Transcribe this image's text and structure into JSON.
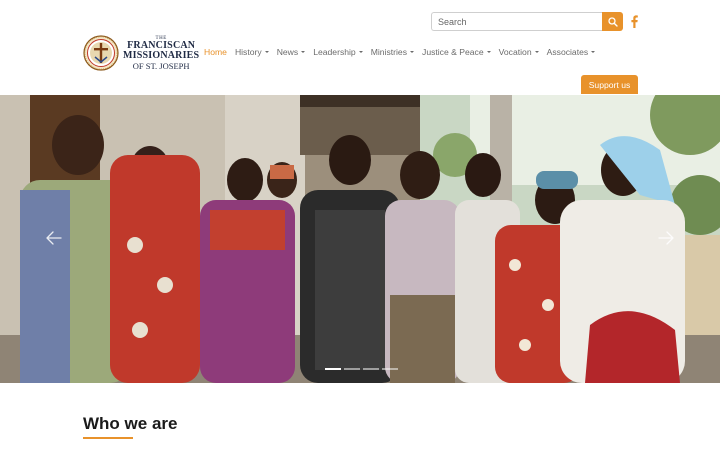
{
  "search": {
    "placeholder": "Search"
  },
  "social": {
    "icon": "facebook-icon"
  },
  "brand": {
    "the": "THE",
    "line1": "FRANCISCAN",
    "line2": "MISSIONARIES",
    "line3": "OF ST. JOSEPH"
  },
  "nav": {
    "items": [
      {
        "label": "Home",
        "dropdown": false,
        "active": true
      },
      {
        "label": "History",
        "dropdown": true
      },
      {
        "label": "News",
        "dropdown": true
      },
      {
        "label": "Leadership",
        "dropdown": true
      },
      {
        "label": "Ministries",
        "dropdown": true
      },
      {
        "label": "Justice & Peace",
        "dropdown": true
      },
      {
        "label": "Vocation",
        "dropdown": true
      },
      {
        "label": "Associates",
        "dropdown": true
      }
    ]
  },
  "support_label": "Support us",
  "carousel": {
    "slides": 4,
    "active_index": 0
  },
  "section": {
    "title": "Who we are"
  },
  "colors": {
    "accent": "#e8922b",
    "brand_navy": "#1f2a44",
    "nav_text": "#6b6b6b"
  }
}
